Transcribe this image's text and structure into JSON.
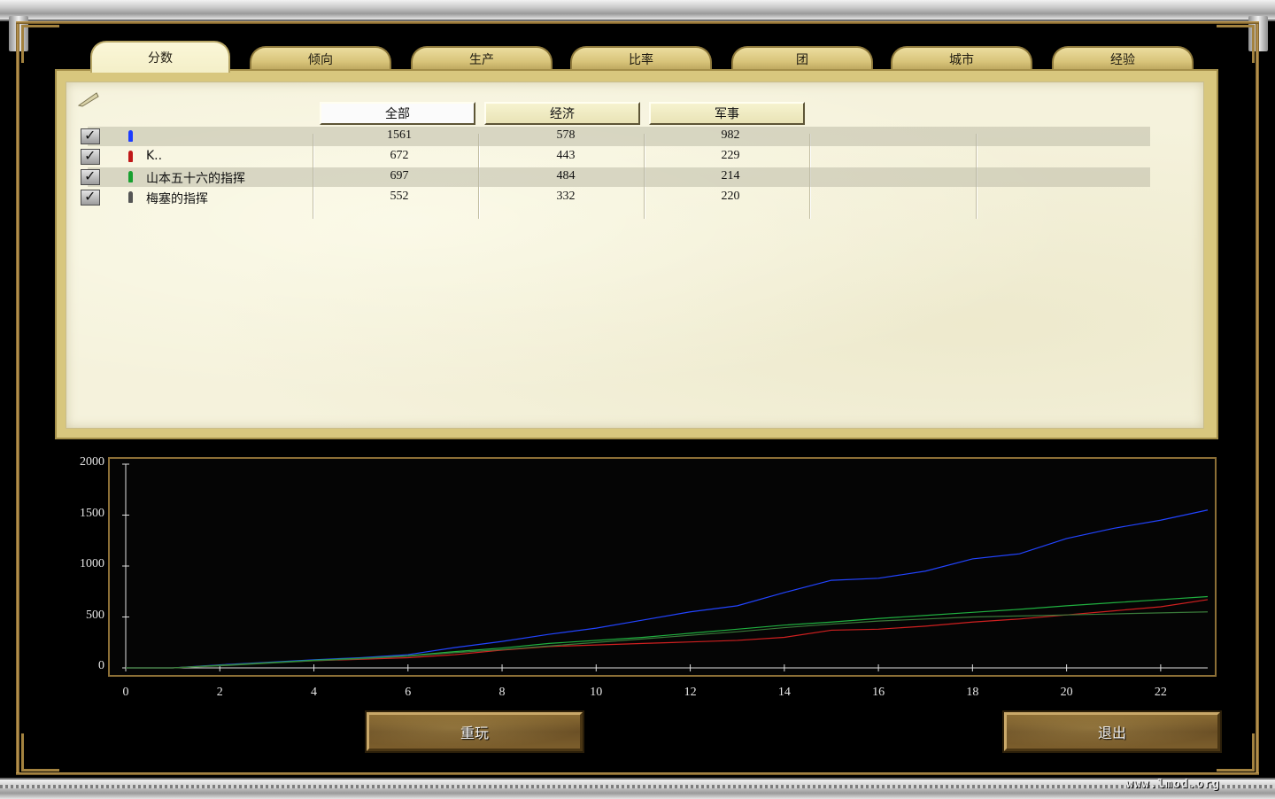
{
  "tabs": [
    "分数",
    "倾向",
    "生产",
    "比率",
    "团",
    "城市",
    "经验"
  ],
  "active_tab": 0,
  "filters": [
    {
      "label": "全部",
      "active": true
    },
    {
      "label": "经济",
      "active": false
    },
    {
      "label": "军事",
      "active": false
    }
  ],
  "players": [
    {
      "name": "",
      "color": "#1c3cff",
      "checked": true,
      "values": [
        "1561",
        "578",
        "982"
      ]
    },
    {
      "name": "K..",
      "color": "#c01818",
      "checked": true,
      "values": [
        "672",
        "443",
        "229"
      ]
    },
    {
      "name": "山本五十六的指挥",
      "color": "#18a030",
      "checked": true,
      "values": [
        "697",
        "484",
        "214"
      ]
    },
    {
      "name": "梅塞的指挥",
      "color": "#555555",
      "checked": true,
      "values": [
        "552",
        "332",
        "220"
      ]
    }
  ],
  "chart_data": {
    "type": "line",
    "title": "",
    "xlabel": "",
    "ylabel": "",
    "xlim": [
      0,
      23
    ],
    "ylim": [
      0,
      2000
    ],
    "x_ticks": [
      0,
      2,
      4,
      6,
      8,
      10,
      12,
      14,
      16,
      18,
      20,
      22
    ],
    "y_ticks": [
      0,
      500,
      1000,
      1500,
      2000
    ],
    "x": [
      0,
      1,
      2,
      3,
      4,
      5,
      6,
      7,
      8,
      9,
      10,
      11,
      12,
      13,
      14,
      15,
      16,
      17,
      18,
      19,
      20,
      21,
      22,
      23
    ],
    "series": [
      {
        "color": "#2244ff",
        "values": [
          0,
          0,
          30,
          55,
          80,
          100,
          130,
          200,
          260,
          330,
          390,
          470,
          550,
          610,
          740,
          860,
          880,
          950,
          1070,
          1120,
          1270,
          1370,
          1450,
          1550
        ]
      },
      {
        "color": "#d02020",
        "values": [
          0,
          0,
          25,
          50,
          70,
          85,
          100,
          130,
          175,
          210,
          225,
          240,
          255,
          270,
          300,
          370,
          380,
          410,
          450,
          480,
          520,
          560,
          600,
          670
        ]
      },
      {
        "color": "#20b040",
        "values": [
          0,
          0,
          25,
          50,
          75,
          95,
          120,
          160,
          195,
          240,
          270,
          300,
          340,
          380,
          420,
          450,
          485,
          515,
          545,
          575,
          610,
          640,
          670,
          700
        ]
      },
      {
        "color": "#3a7a3a",
        "values": [
          0,
          0,
          20,
          45,
          70,
          90,
          115,
          150,
          180,
          215,
          250,
          285,
          320,
          355,
          395,
          430,
          460,
          480,
          500,
          510,
          520,
          530,
          540,
          550
        ]
      }
    ]
  },
  "buttons": {
    "replay": "重玩",
    "exit": "退出"
  },
  "watermark": "www.lmod.org"
}
